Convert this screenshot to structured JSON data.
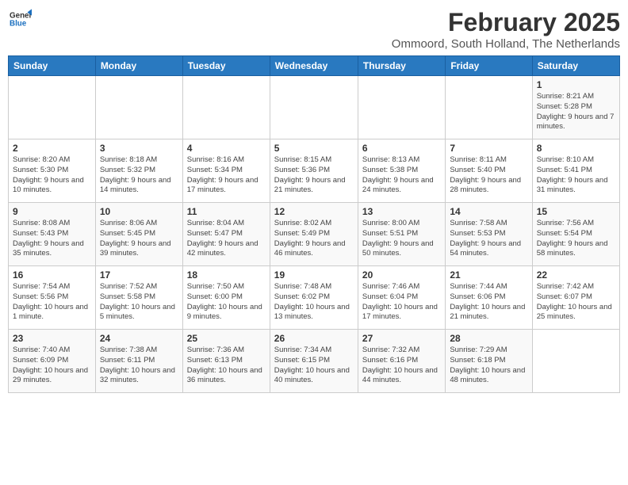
{
  "logo": {
    "line1": "General",
    "line2": "Blue"
  },
  "title": "February 2025",
  "subtitle": "Ommoord, South Holland, The Netherlands",
  "days_of_week": [
    "Sunday",
    "Monday",
    "Tuesday",
    "Wednesday",
    "Thursday",
    "Friday",
    "Saturday"
  ],
  "weeks": [
    [
      {
        "day": "",
        "info": ""
      },
      {
        "day": "",
        "info": ""
      },
      {
        "day": "",
        "info": ""
      },
      {
        "day": "",
        "info": ""
      },
      {
        "day": "",
        "info": ""
      },
      {
        "day": "",
        "info": ""
      },
      {
        "day": "1",
        "info": "Sunrise: 8:21 AM\nSunset: 5:28 PM\nDaylight: 9 hours and 7 minutes."
      }
    ],
    [
      {
        "day": "2",
        "info": "Sunrise: 8:20 AM\nSunset: 5:30 PM\nDaylight: 9 hours and 10 minutes."
      },
      {
        "day": "3",
        "info": "Sunrise: 8:18 AM\nSunset: 5:32 PM\nDaylight: 9 hours and 14 minutes."
      },
      {
        "day": "4",
        "info": "Sunrise: 8:16 AM\nSunset: 5:34 PM\nDaylight: 9 hours and 17 minutes."
      },
      {
        "day": "5",
        "info": "Sunrise: 8:15 AM\nSunset: 5:36 PM\nDaylight: 9 hours and 21 minutes."
      },
      {
        "day": "6",
        "info": "Sunrise: 8:13 AM\nSunset: 5:38 PM\nDaylight: 9 hours and 24 minutes."
      },
      {
        "day": "7",
        "info": "Sunrise: 8:11 AM\nSunset: 5:40 PM\nDaylight: 9 hours and 28 minutes."
      },
      {
        "day": "8",
        "info": "Sunrise: 8:10 AM\nSunset: 5:41 PM\nDaylight: 9 hours and 31 minutes."
      }
    ],
    [
      {
        "day": "9",
        "info": "Sunrise: 8:08 AM\nSunset: 5:43 PM\nDaylight: 9 hours and 35 minutes."
      },
      {
        "day": "10",
        "info": "Sunrise: 8:06 AM\nSunset: 5:45 PM\nDaylight: 9 hours and 39 minutes."
      },
      {
        "day": "11",
        "info": "Sunrise: 8:04 AM\nSunset: 5:47 PM\nDaylight: 9 hours and 42 minutes."
      },
      {
        "day": "12",
        "info": "Sunrise: 8:02 AM\nSunset: 5:49 PM\nDaylight: 9 hours and 46 minutes."
      },
      {
        "day": "13",
        "info": "Sunrise: 8:00 AM\nSunset: 5:51 PM\nDaylight: 9 hours and 50 minutes."
      },
      {
        "day": "14",
        "info": "Sunrise: 7:58 AM\nSunset: 5:53 PM\nDaylight: 9 hours and 54 minutes."
      },
      {
        "day": "15",
        "info": "Sunrise: 7:56 AM\nSunset: 5:54 PM\nDaylight: 9 hours and 58 minutes."
      }
    ],
    [
      {
        "day": "16",
        "info": "Sunrise: 7:54 AM\nSunset: 5:56 PM\nDaylight: 10 hours and 1 minute."
      },
      {
        "day": "17",
        "info": "Sunrise: 7:52 AM\nSunset: 5:58 PM\nDaylight: 10 hours and 5 minutes."
      },
      {
        "day": "18",
        "info": "Sunrise: 7:50 AM\nSunset: 6:00 PM\nDaylight: 10 hours and 9 minutes."
      },
      {
        "day": "19",
        "info": "Sunrise: 7:48 AM\nSunset: 6:02 PM\nDaylight: 10 hours and 13 minutes."
      },
      {
        "day": "20",
        "info": "Sunrise: 7:46 AM\nSunset: 6:04 PM\nDaylight: 10 hours and 17 minutes."
      },
      {
        "day": "21",
        "info": "Sunrise: 7:44 AM\nSunset: 6:06 PM\nDaylight: 10 hours and 21 minutes."
      },
      {
        "day": "22",
        "info": "Sunrise: 7:42 AM\nSunset: 6:07 PM\nDaylight: 10 hours and 25 minutes."
      }
    ],
    [
      {
        "day": "23",
        "info": "Sunrise: 7:40 AM\nSunset: 6:09 PM\nDaylight: 10 hours and 29 minutes."
      },
      {
        "day": "24",
        "info": "Sunrise: 7:38 AM\nSunset: 6:11 PM\nDaylight: 10 hours and 32 minutes."
      },
      {
        "day": "25",
        "info": "Sunrise: 7:36 AM\nSunset: 6:13 PM\nDaylight: 10 hours and 36 minutes."
      },
      {
        "day": "26",
        "info": "Sunrise: 7:34 AM\nSunset: 6:15 PM\nDaylight: 10 hours and 40 minutes."
      },
      {
        "day": "27",
        "info": "Sunrise: 7:32 AM\nSunset: 6:16 PM\nDaylight: 10 hours and 44 minutes."
      },
      {
        "day": "28",
        "info": "Sunrise: 7:29 AM\nSunset: 6:18 PM\nDaylight: 10 hours and 48 minutes."
      },
      {
        "day": "",
        "info": ""
      }
    ]
  ]
}
